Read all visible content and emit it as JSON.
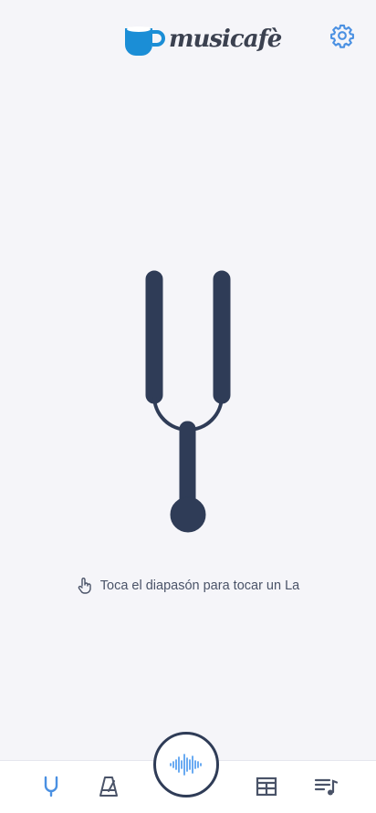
{
  "app": {
    "brand": "musicafè"
  },
  "tuner": {
    "hint_text": "Toca el diapasón para tocar un La"
  },
  "icons": {
    "settings": "gear-icon",
    "hint": "hand-pointer-icon",
    "nav": [
      "tuning-fork-icon",
      "metronome-icon",
      "waveform-icon",
      "chord-grid-icon",
      "playlist-music-icon"
    ]
  },
  "colors": {
    "accent": "#4a90e2",
    "fork": "#2f3c57",
    "background": "#f5f5f9",
    "wave": "#5aa2f0"
  }
}
